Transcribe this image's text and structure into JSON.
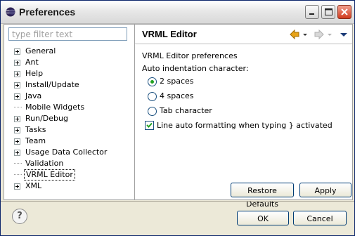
{
  "window": {
    "title": "Preferences",
    "controls": [
      "minimize-icon",
      "maximize-icon",
      "close-icon"
    ]
  },
  "sidebar": {
    "filter_placeholder": "type filter text",
    "filter_value": "",
    "items": [
      {
        "label": "General",
        "expandable": true
      },
      {
        "label": "Ant",
        "expandable": true
      },
      {
        "label": "Help",
        "expandable": true
      },
      {
        "label": "Install/Update",
        "expandable": true
      },
      {
        "label": "Java",
        "expandable": true
      },
      {
        "label": "Mobile Widgets",
        "expandable": false
      },
      {
        "label": "Run/Debug",
        "expandable": true
      },
      {
        "label": "Tasks",
        "expandable": true
      },
      {
        "label": "Team",
        "expandable": true
      },
      {
        "label": "Usage Data Collector",
        "expandable": true
      },
      {
        "label": "Validation",
        "expandable": false
      },
      {
        "label": "VRML Editor",
        "expandable": false,
        "selected": true
      },
      {
        "label": "XML",
        "expandable": true
      }
    ]
  },
  "main": {
    "title": "VRML Editor",
    "description": "VRML Editor preferences",
    "indent_label": "Auto indentation character:",
    "radios": [
      {
        "label": "2 spaces",
        "checked": true
      },
      {
        "label": "4 spaces",
        "checked": false
      },
      {
        "label": "Tab character",
        "checked": false
      }
    ],
    "checkbox": {
      "label": "Line auto formatting when typing } activated",
      "checked": true
    },
    "restore_label": "Restore Defaults",
    "apply_label": "Apply"
  },
  "footer": {
    "ok_label": "OK",
    "cancel_label": "Cancel"
  },
  "colors": {
    "radio_selected": "#21a121",
    "nav_back": "#e8a317",
    "accent": "#0a246a"
  }
}
